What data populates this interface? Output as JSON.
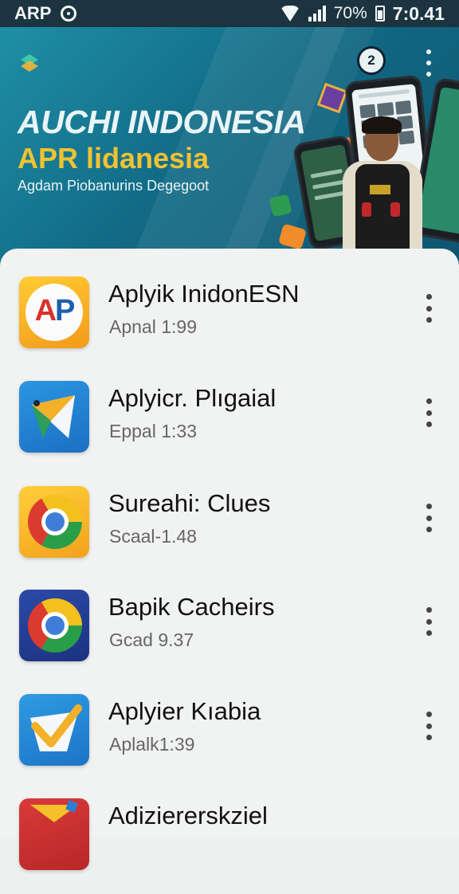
{
  "status_bar": {
    "app_label": "ARP",
    "battery_percent": "70%",
    "time": "7:0.41"
  },
  "banner": {
    "title": "AUCHI INDONESIA",
    "subtitle": "APR lidanesia",
    "tagline": "Agdam Piobanurins Degegoot",
    "history_badge": "2"
  },
  "apps": [
    {
      "name": "Aplyik InidonESN",
      "meta": "Apnal 1:99",
      "icon": "ap-logo-icon"
    },
    {
      "name": "Aplyicr. Plıgaial",
      "meta": "Eppal 1:33",
      "icon": "mail-paper-plane-icon"
    },
    {
      "name": "Sureahi: Clues",
      "meta": "Scaal-1.48",
      "icon": "chrome-icon"
    },
    {
      "name": "Bapik Cacheirs",
      "meta": "Gcad 9.37",
      "icon": "chrome-icon"
    },
    {
      "name": "Aplyier Kıabia",
      "meta": "Aplalk1:39",
      "icon": "mail-check-icon"
    },
    {
      "name": "Adiziererskziel",
      "meta": "",
      "icon": "gmail-icon"
    }
  ],
  "colors": {
    "status_bar": "#1b3440",
    "banner_start": "#1f8fa6",
    "banner_end": "#0f5470",
    "subtitle_yellow": "#f1c232",
    "sheet_bg": "#f1f2f2"
  }
}
